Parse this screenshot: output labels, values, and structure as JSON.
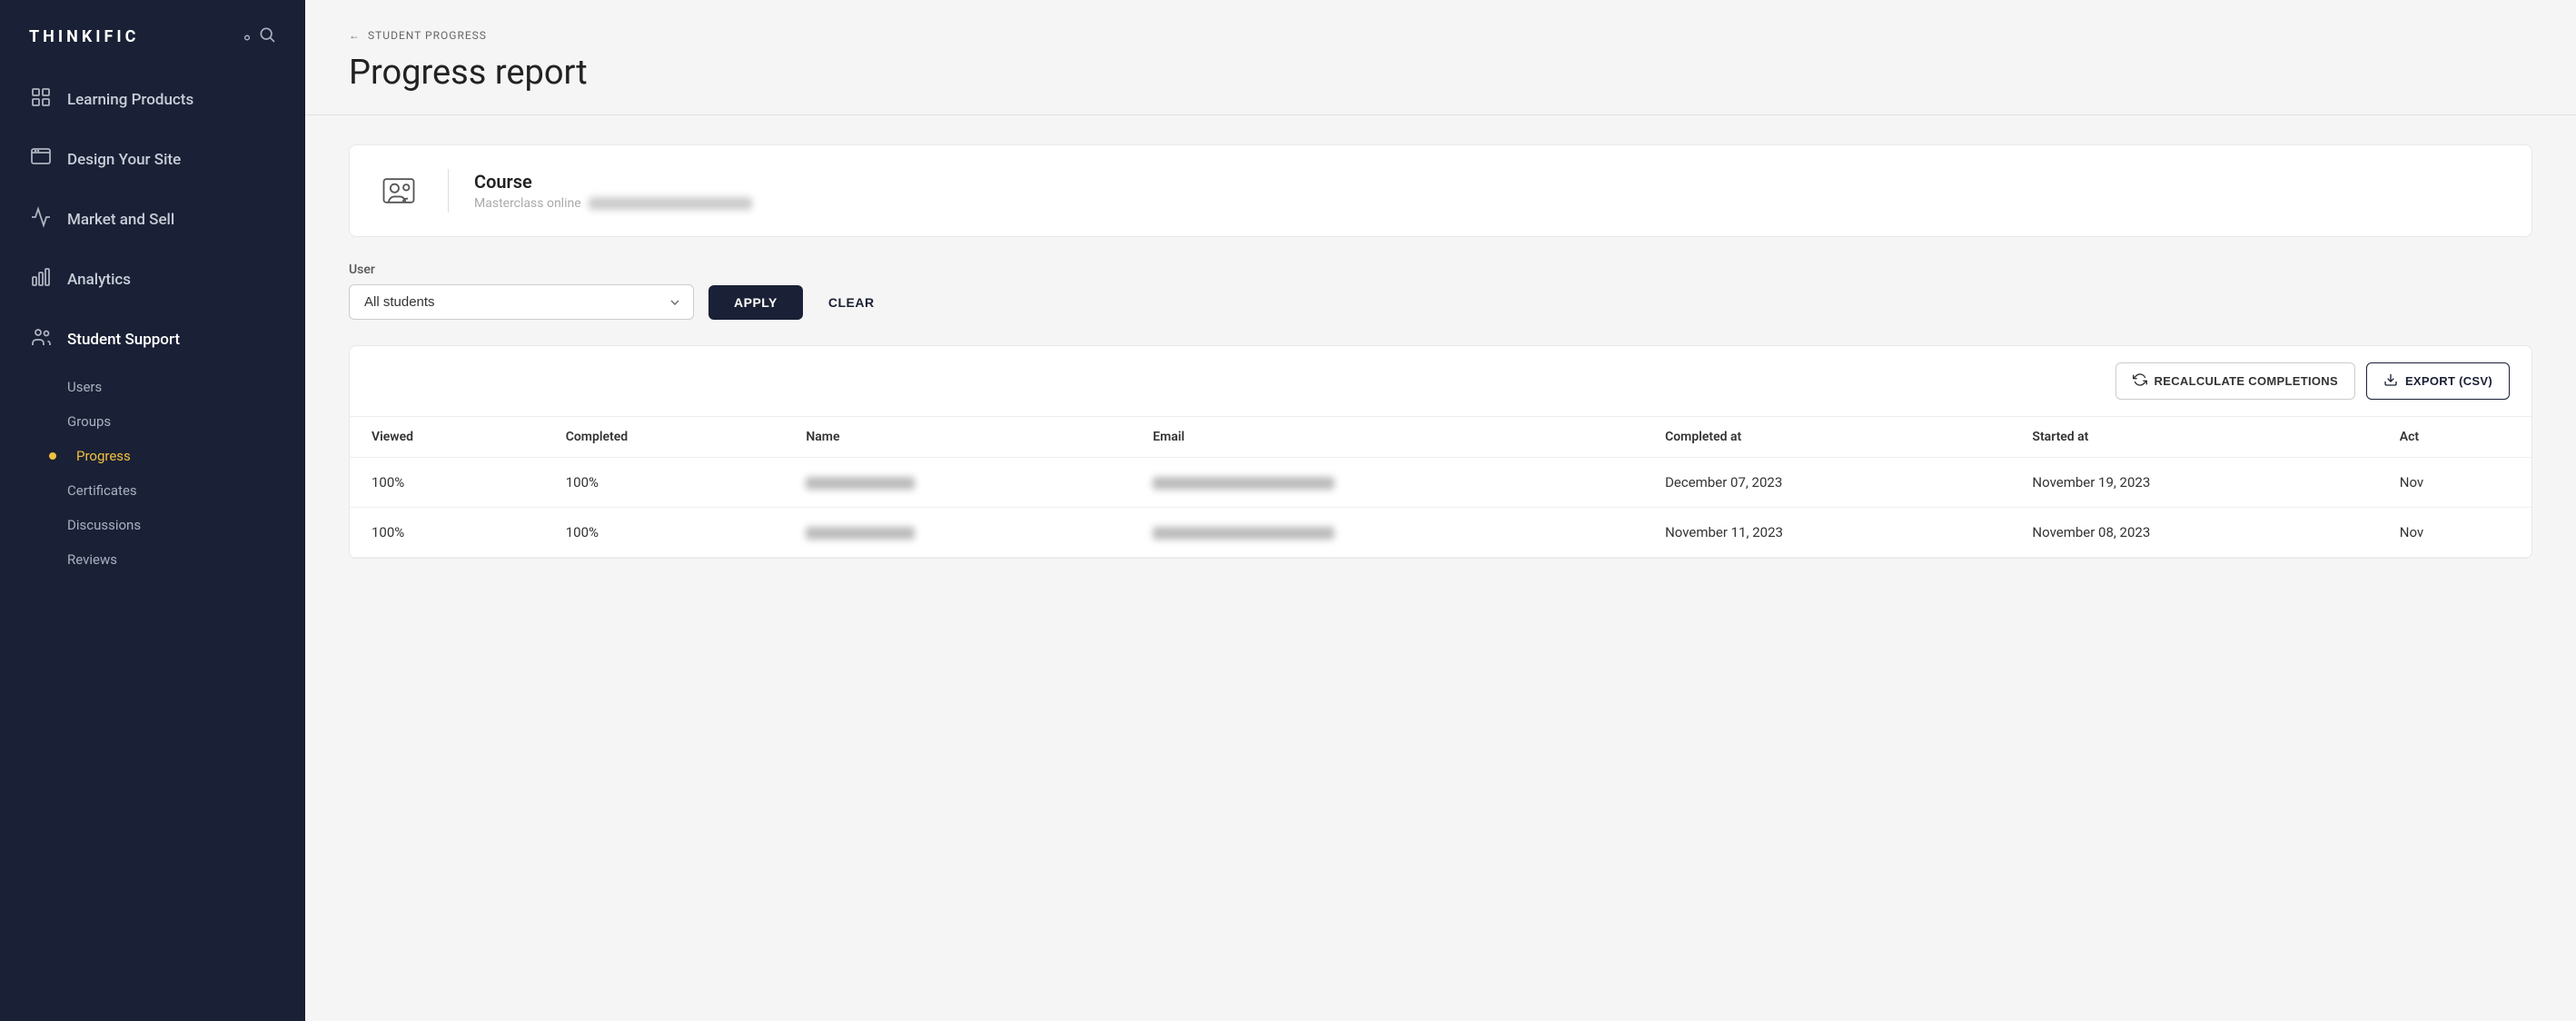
{
  "sidebar": {
    "logo": "THINKIFIC",
    "nav_items": [
      {
        "id": "learning-products",
        "label": "Learning Products",
        "icon": "📋"
      },
      {
        "id": "design-your-site",
        "label": "Design Your Site",
        "icon": "🖼"
      },
      {
        "id": "market-and-sell",
        "label": "Market and Sell",
        "icon": "📊"
      },
      {
        "id": "analytics",
        "label": "Analytics",
        "icon": "📈"
      },
      {
        "id": "student-support",
        "label": "Student Support",
        "icon": "👥"
      }
    ],
    "sub_nav": [
      {
        "id": "users",
        "label": "Users",
        "active": false
      },
      {
        "id": "groups",
        "label": "Groups",
        "active": false
      },
      {
        "id": "progress",
        "label": "Progress",
        "active": true
      },
      {
        "id": "certificates",
        "label": "Certificates",
        "active": false
      },
      {
        "id": "discussions",
        "label": "Discussions",
        "active": false
      },
      {
        "id": "reviews",
        "label": "Reviews",
        "active": false
      }
    ]
  },
  "breadcrumb": {
    "back_arrow": "←",
    "text": "STUDENT PROGRESS"
  },
  "page": {
    "title": "Progress report"
  },
  "course_card": {
    "type_label": "Course",
    "subtitle": "Masterclass online"
  },
  "filter": {
    "user_label": "User",
    "select_default": "All students",
    "apply_label": "APPLY",
    "clear_label": "CLEAR"
  },
  "table": {
    "recalc_label": "RECALCULATE COMPLETIONS",
    "export_label": "EXPORT (CSV)",
    "columns": [
      "Viewed",
      "Completed",
      "Name",
      "Email",
      "Completed at",
      "Started at",
      "Act"
    ],
    "rows": [
      {
        "viewed": "100%",
        "completed": "100%",
        "name_blur": true,
        "email_blur": true,
        "completed_at": "December 07, 2023",
        "started_at": "November 19, 2023",
        "act": "Nov"
      },
      {
        "viewed": "100%",
        "completed": "100%",
        "name_blur": true,
        "email_blur": true,
        "completed_at": "November 11, 2023",
        "started_at": "November 08, 2023",
        "act": "Nov"
      }
    ]
  }
}
